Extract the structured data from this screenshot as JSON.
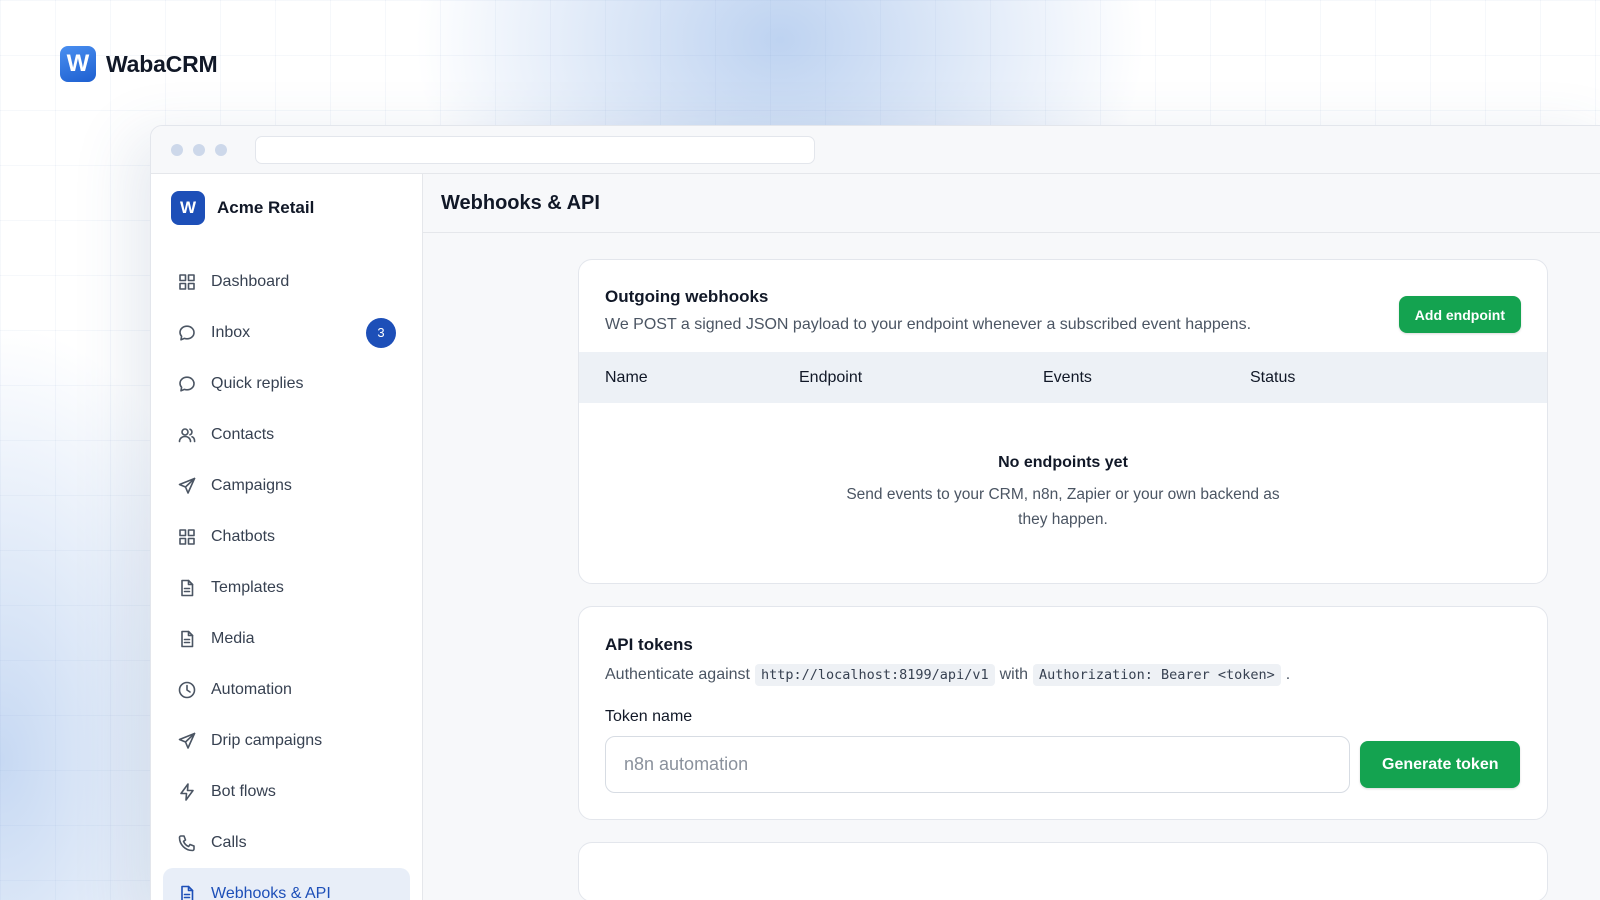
{
  "brand": {
    "logo_letter": "W",
    "name": "WabaCRM"
  },
  "workspace": {
    "logo_letter": "W",
    "name": "Acme Retail"
  },
  "sidebar": {
    "items": [
      {
        "label": "Dashboard",
        "icon": "grid-icon"
      },
      {
        "label": "Inbox",
        "icon": "chat-bubble-icon",
        "badge": "3"
      },
      {
        "label": "Quick replies",
        "icon": "chat-bubble-icon"
      },
      {
        "label": "Contacts",
        "icon": "users-icon"
      },
      {
        "label": "Campaigns",
        "icon": "send-icon"
      },
      {
        "label": "Chatbots",
        "icon": "grid-icon"
      },
      {
        "label": "Templates",
        "icon": "document-icon"
      },
      {
        "label": "Media",
        "icon": "document-icon"
      },
      {
        "label": "Automation",
        "icon": "clock-icon"
      },
      {
        "label": "Drip campaigns",
        "icon": "send-icon"
      },
      {
        "label": "Bot flows",
        "icon": "bolt-icon"
      },
      {
        "label": "Calls",
        "icon": "phone-icon"
      },
      {
        "label": "Webhooks & API",
        "icon": "document-icon",
        "active": true
      }
    ]
  },
  "header": {
    "title": "Webhooks & API"
  },
  "webhooks": {
    "title": "Outgoing webhooks",
    "subtitle": "We POST a signed JSON payload to your endpoint whenever a subscribed event happens.",
    "add_label": "Add endpoint",
    "columns": [
      "Name",
      "Endpoint",
      "Events",
      "Status"
    ],
    "empty_title": "No endpoints yet",
    "empty_subtitle": "Send events to your CRM, n8n, Zapier or your own backend as they happen."
  },
  "api_tokens": {
    "title": "API tokens",
    "auth_prefix": "Authenticate against",
    "base_url": "http://localhost:8199/api/v1",
    "auth_mid": "with",
    "auth_header": "Authorization: Bearer <token>",
    "auth_suffix": ".",
    "field_label": "Token name",
    "placeholder": "n8n automation",
    "generate_label": "Generate token"
  },
  "colors": {
    "accent": "#1d4fb8",
    "success": "#14a350"
  }
}
